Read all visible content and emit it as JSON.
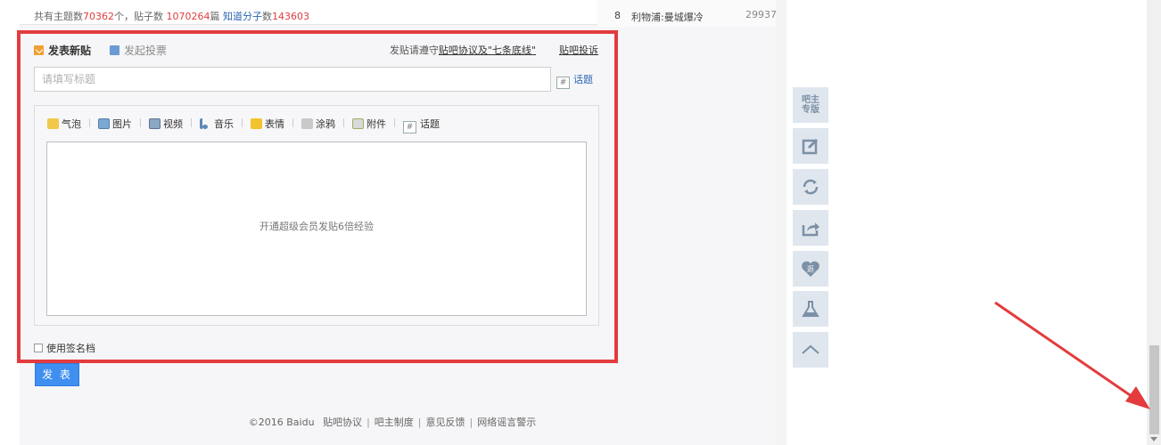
{
  "stats": {
    "topics_prefix": "共有主题数",
    "topics_count": "70362",
    "topics_unit": "个，",
    "posts_prefix": "贴子数 ",
    "posts_count": "1070264",
    "posts_unit": "篇 ",
    "members_label": "知道分子",
    "members_prefix": "数",
    "members_count": "143603"
  },
  "rank_list": {
    "rank": "8",
    "name": "利物浦:曼城爆冷",
    "count": "29937"
  },
  "editor": {
    "tab_new": "发表新贴",
    "tab_vote": "发起投票",
    "notice_prefix": "发贴请遵守",
    "notice_link": "贴吧协议及\"七条底线\"",
    "report_link": "贴吧投诉",
    "title_placeholder": "请填写标题",
    "topic_button": "话题",
    "topic_hash": "#",
    "toolbar": [
      {
        "label": "气泡",
        "icon": "bubble-icon"
      },
      {
        "label": "图片",
        "icon": "picture-icon"
      },
      {
        "label": "视频",
        "icon": "video-icon"
      },
      {
        "label": "音乐",
        "icon": "music-icon"
      },
      {
        "label": "表情",
        "icon": "emoji-icon"
      },
      {
        "label": "涂鸦",
        "icon": "doodle-icon"
      },
      {
        "label": "附件",
        "icon": "attachment-icon"
      },
      {
        "label": "话题",
        "icon": "topic-icon"
      }
    ],
    "content_placeholder": "开通超级会员发贴6倍经验",
    "signature_label": "使用签名档",
    "submit_label": "发 表"
  },
  "footer": {
    "copyright": "©2016 Baidu",
    "links": [
      "贴吧协议",
      "吧主制度",
      "意见反馈",
      "网络谣言警示"
    ]
  },
  "side_tools": {
    "moderator_label_1": "吧主",
    "moderator_label_2": "专版",
    "items": [
      "moderator-panel",
      "edit-icon",
      "refresh-icon",
      "share-icon",
      "heart-badge-icon",
      "flask-icon",
      "back-to-top-icon"
    ],
    "heart_text": "逛"
  },
  "colors": {
    "highlight": "#e33b3e",
    "link_blue": "#2d64b3",
    "number_red": "#e03c3c",
    "submit_blue": "#3f8ff1",
    "side_tool_bg": "#dfe6ee"
  }
}
